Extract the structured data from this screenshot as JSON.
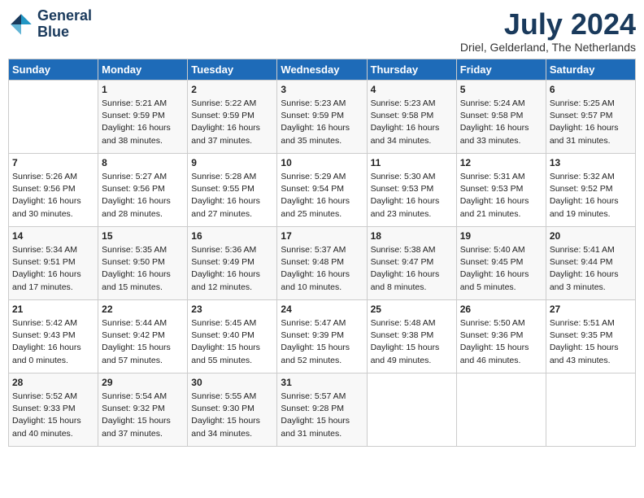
{
  "header": {
    "logo_line1": "General",
    "logo_line2": "Blue",
    "month_title": "July 2024",
    "location": "Driel, Gelderland, The Netherlands"
  },
  "days_of_week": [
    "Sunday",
    "Monday",
    "Tuesday",
    "Wednesday",
    "Thursday",
    "Friday",
    "Saturday"
  ],
  "weeks": [
    [
      {
        "day": "",
        "content": ""
      },
      {
        "day": "1",
        "content": "Sunrise: 5:21 AM\nSunset: 9:59 PM\nDaylight: 16 hours\nand 38 minutes."
      },
      {
        "day": "2",
        "content": "Sunrise: 5:22 AM\nSunset: 9:59 PM\nDaylight: 16 hours\nand 37 minutes."
      },
      {
        "day": "3",
        "content": "Sunrise: 5:23 AM\nSunset: 9:59 PM\nDaylight: 16 hours\nand 35 minutes."
      },
      {
        "day": "4",
        "content": "Sunrise: 5:23 AM\nSunset: 9:58 PM\nDaylight: 16 hours\nand 34 minutes."
      },
      {
        "day": "5",
        "content": "Sunrise: 5:24 AM\nSunset: 9:58 PM\nDaylight: 16 hours\nand 33 minutes."
      },
      {
        "day": "6",
        "content": "Sunrise: 5:25 AM\nSunset: 9:57 PM\nDaylight: 16 hours\nand 31 minutes."
      }
    ],
    [
      {
        "day": "7",
        "content": "Sunrise: 5:26 AM\nSunset: 9:56 PM\nDaylight: 16 hours\nand 30 minutes."
      },
      {
        "day": "8",
        "content": "Sunrise: 5:27 AM\nSunset: 9:56 PM\nDaylight: 16 hours\nand 28 minutes."
      },
      {
        "day": "9",
        "content": "Sunrise: 5:28 AM\nSunset: 9:55 PM\nDaylight: 16 hours\nand 27 minutes."
      },
      {
        "day": "10",
        "content": "Sunrise: 5:29 AM\nSunset: 9:54 PM\nDaylight: 16 hours\nand 25 minutes."
      },
      {
        "day": "11",
        "content": "Sunrise: 5:30 AM\nSunset: 9:53 PM\nDaylight: 16 hours\nand 23 minutes."
      },
      {
        "day": "12",
        "content": "Sunrise: 5:31 AM\nSunset: 9:53 PM\nDaylight: 16 hours\nand 21 minutes."
      },
      {
        "day": "13",
        "content": "Sunrise: 5:32 AM\nSunset: 9:52 PM\nDaylight: 16 hours\nand 19 minutes."
      }
    ],
    [
      {
        "day": "14",
        "content": "Sunrise: 5:34 AM\nSunset: 9:51 PM\nDaylight: 16 hours\nand 17 minutes."
      },
      {
        "day": "15",
        "content": "Sunrise: 5:35 AM\nSunset: 9:50 PM\nDaylight: 16 hours\nand 15 minutes."
      },
      {
        "day": "16",
        "content": "Sunrise: 5:36 AM\nSunset: 9:49 PM\nDaylight: 16 hours\nand 12 minutes."
      },
      {
        "day": "17",
        "content": "Sunrise: 5:37 AM\nSunset: 9:48 PM\nDaylight: 16 hours\nand 10 minutes."
      },
      {
        "day": "18",
        "content": "Sunrise: 5:38 AM\nSunset: 9:47 PM\nDaylight: 16 hours\nand 8 minutes."
      },
      {
        "day": "19",
        "content": "Sunrise: 5:40 AM\nSunset: 9:45 PM\nDaylight: 16 hours\nand 5 minutes."
      },
      {
        "day": "20",
        "content": "Sunrise: 5:41 AM\nSunset: 9:44 PM\nDaylight: 16 hours\nand 3 minutes."
      }
    ],
    [
      {
        "day": "21",
        "content": "Sunrise: 5:42 AM\nSunset: 9:43 PM\nDaylight: 16 hours\nand 0 minutes."
      },
      {
        "day": "22",
        "content": "Sunrise: 5:44 AM\nSunset: 9:42 PM\nDaylight: 15 hours\nand 57 minutes."
      },
      {
        "day": "23",
        "content": "Sunrise: 5:45 AM\nSunset: 9:40 PM\nDaylight: 15 hours\nand 55 minutes."
      },
      {
        "day": "24",
        "content": "Sunrise: 5:47 AM\nSunset: 9:39 PM\nDaylight: 15 hours\nand 52 minutes."
      },
      {
        "day": "25",
        "content": "Sunrise: 5:48 AM\nSunset: 9:38 PM\nDaylight: 15 hours\nand 49 minutes."
      },
      {
        "day": "26",
        "content": "Sunrise: 5:50 AM\nSunset: 9:36 PM\nDaylight: 15 hours\nand 46 minutes."
      },
      {
        "day": "27",
        "content": "Sunrise: 5:51 AM\nSunset: 9:35 PM\nDaylight: 15 hours\nand 43 minutes."
      }
    ],
    [
      {
        "day": "28",
        "content": "Sunrise: 5:52 AM\nSunset: 9:33 PM\nDaylight: 15 hours\nand 40 minutes."
      },
      {
        "day": "29",
        "content": "Sunrise: 5:54 AM\nSunset: 9:32 PM\nDaylight: 15 hours\nand 37 minutes."
      },
      {
        "day": "30",
        "content": "Sunrise: 5:55 AM\nSunset: 9:30 PM\nDaylight: 15 hours\nand 34 minutes."
      },
      {
        "day": "31",
        "content": "Sunrise: 5:57 AM\nSunset: 9:28 PM\nDaylight: 15 hours\nand 31 minutes."
      },
      {
        "day": "",
        "content": ""
      },
      {
        "day": "",
        "content": ""
      },
      {
        "day": "",
        "content": ""
      }
    ]
  ]
}
